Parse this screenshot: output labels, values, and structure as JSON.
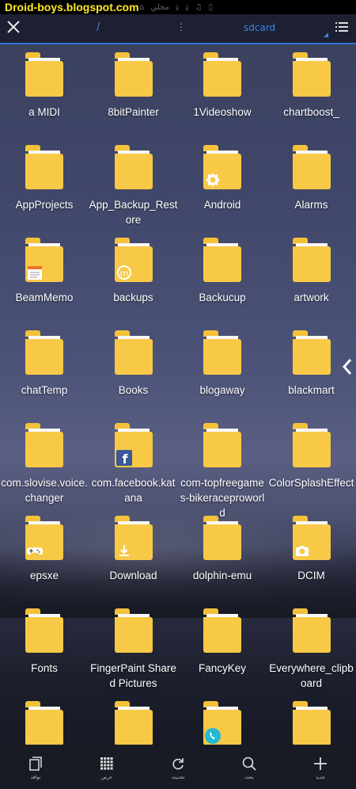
{
  "watermark": "Droid-boys.blogspot.com",
  "status_bar": {
    "icons": [
      "home-icon",
      "chat-icon",
      "download-icon",
      "download-icon",
      "music-icon",
      "sim-icon"
    ],
    "local_label": "محلي"
  },
  "toolbar": {
    "path_root": "/",
    "path_separator": "⋮",
    "current_dir": "sdcard"
  },
  "folders": [
    {
      "name": "a MIDI",
      "badge": ""
    },
    {
      "name": "8bitPainter",
      "badge": ""
    },
    {
      "name": "1Videoshow",
      "badge": ""
    },
    {
      "name": "chartboost_",
      "badge": ""
    },
    {
      "name": "AppProjects",
      "badge": ""
    },
    {
      "name": "App_Backup_Restore",
      "badge": ""
    },
    {
      "name": "Android",
      "badge": "gear-icon"
    },
    {
      "name": "Alarms",
      "badge": ""
    },
    {
      "name": "BeamMemo",
      "badge": "notepad-icon"
    },
    {
      "name": "backups",
      "badge": "backup-icon"
    },
    {
      "name": "Backucup",
      "badge": ""
    },
    {
      "name": "artwork",
      "badge": ""
    },
    {
      "name": "chatTemp",
      "badge": ""
    },
    {
      "name": "Books",
      "badge": ""
    },
    {
      "name": "blogaway",
      "badge": ""
    },
    {
      "name": "blackmart",
      "badge": ""
    },
    {
      "name": "com.slovise.voice.changer",
      "badge": ""
    },
    {
      "name": "com.facebook.katana",
      "badge": "facebook-icon"
    },
    {
      "name": "com-topfreegames-bikeraceproworld",
      "badge": ""
    },
    {
      "name": "ColorSplashEffect",
      "badge": ""
    },
    {
      "name": "epsxe",
      "badge": "gamepad-icon"
    },
    {
      "name": "Download",
      "badge": "download-icon"
    },
    {
      "name": "dolphin-emu",
      "badge": ""
    },
    {
      "name": "DCIM",
      "badge": "camera-icon"
    },
    {
      "name": "Fonts",
      "badge": ""
    },
    {
      "name": "FingerPaint Shared Pictures",
      "badge": ""
    },
    {
      "name": "FancyKey",
      "badge": ""
    },
    {
      "name": "Everywhere_clipboard",
      "badge": ""
    },
    {
      "name": "",
      "badge": ""
    },
    {
      "name": "",
      "badge": ""
    },
    {
      "name": "",
      "badge": "phone-icon"
    },
    {
      "name": "",
      "badge": ""
    }
  ],
  "bottom_nav": [
    {
      "label": "نوافذ",
      "icon": "windows-icon"
    },
    {
      "label": "عرض",
      "icon": "grid-view-icon"
    },
    {
      "label": "تحديث",
      "icon": "refresh-icon"
    },
    {
      "label": "بحث",
      "icon": "search-icon"
    },
    {
      "label": "جديد",
      "icon": "plus-icon"
    }
  ],
  "colors": {
    "accent": "#3f86e8",
    "folder": "#f7c946",
    "watermark": "#ffe926"
  }
}
